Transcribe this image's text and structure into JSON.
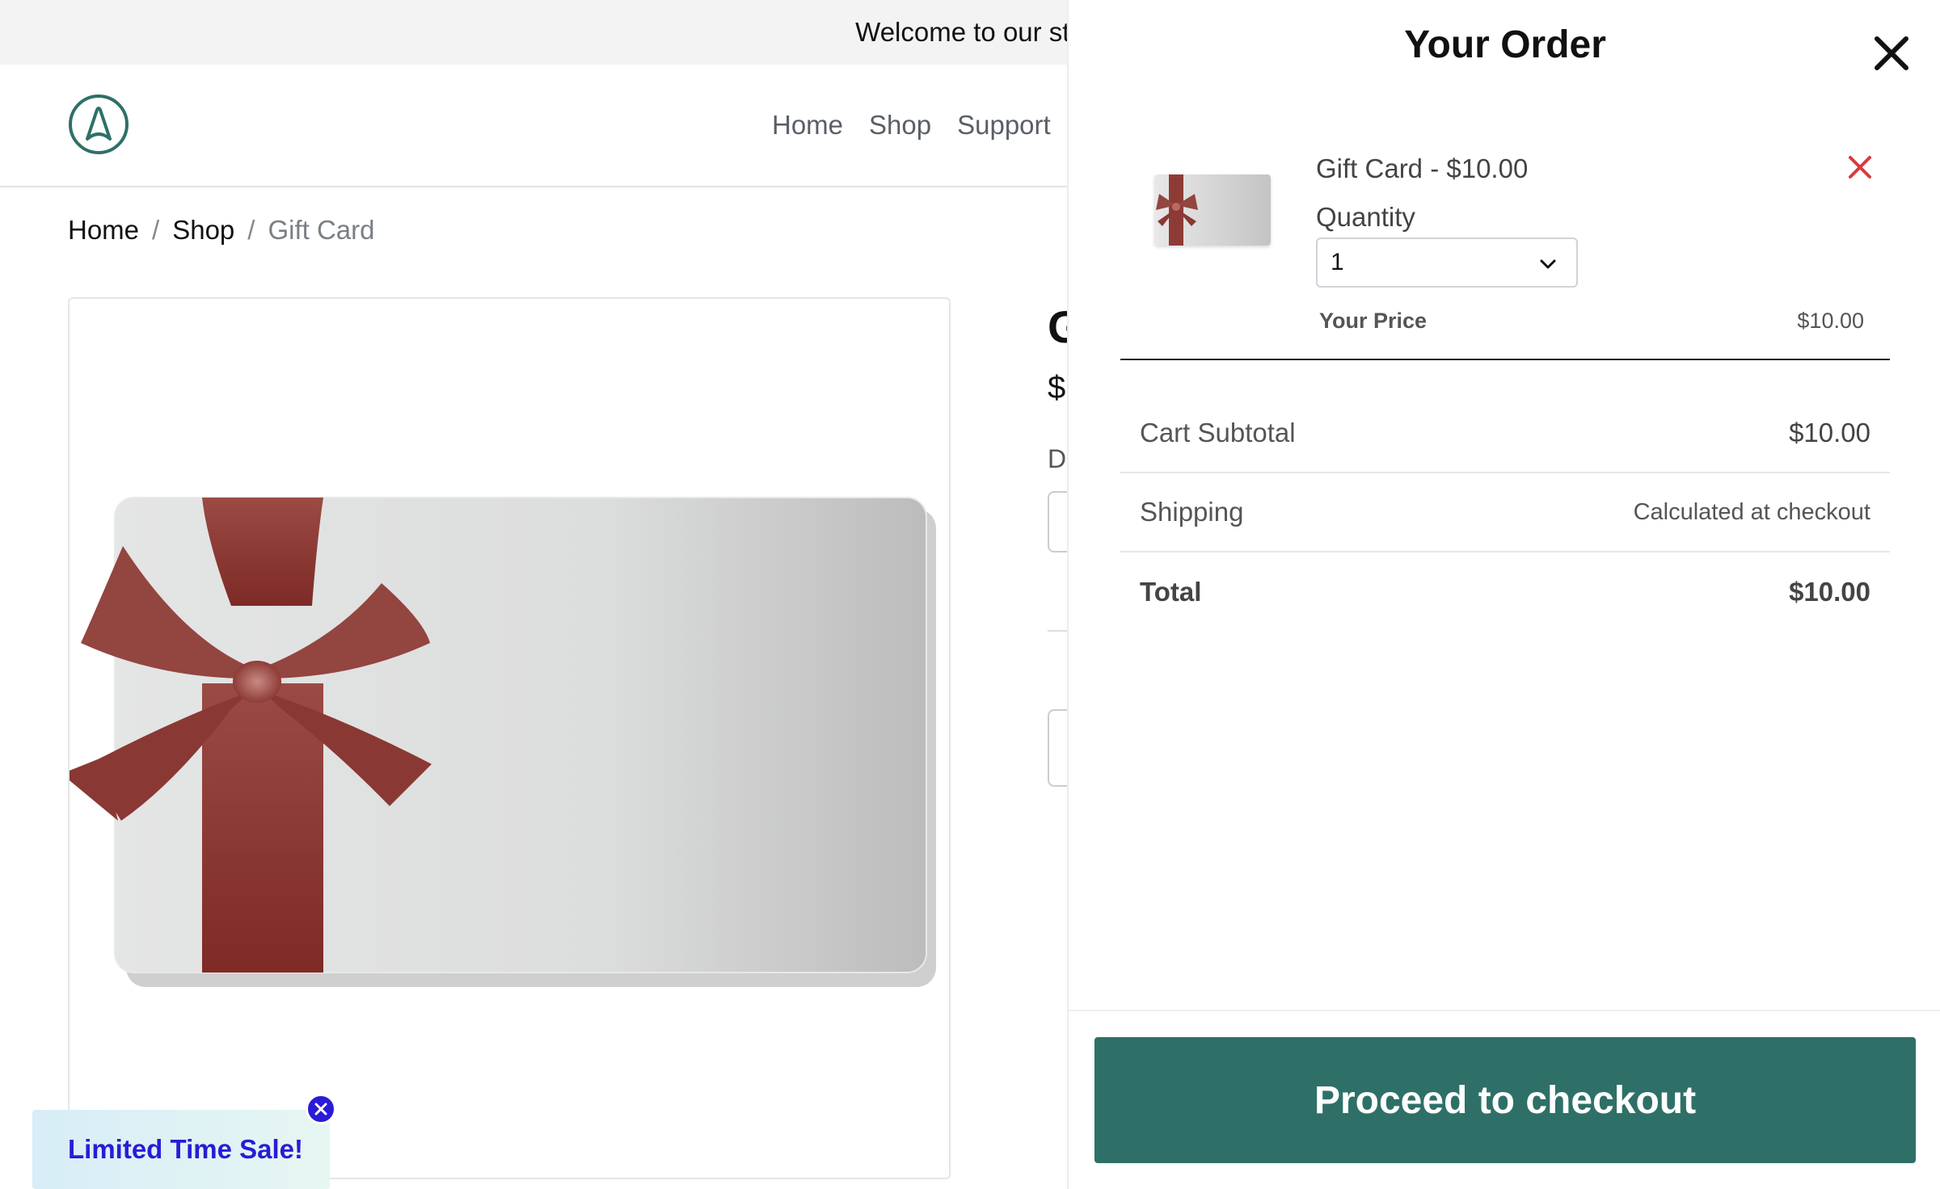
{
  "announcement": {
    "text": "Welcome to our sto"
  },
  "header": {
    "logo_icon": "store-logo-icon",
    "nav": [
      "Home",
      "Shop",
      "Support"
    ]
  },
  "breadcrumb": {
    "items": [
      "Home",
      "Shop"
    ],
    "current": "Gift Card",
    "separator": "/"
  },
  "product": {
    "title_peek": "G",
    "price_peek": "$",
    "label_peek": "D"
  },
  "promo": {
    "label": "Limited Time Sale!",
    "close_icon": "close-circle-icon"
  },
  "cart": {
    "title": "Your Order",
    "close_icon": "close-icon",
    "item": {
      "name": "Gift Card - $10.00",
      "quantity_label": "Quantity",
      "quantity_value": "1",
      "price_label": "Your Price",
      "price_value": "$10.00",
      "remove_icon": "remove-x-icon"
    },
    "summary": {
      "subtotal_label": "Cart Subtotal",
      "subtotal_value": "$10.00",
      "shipping_label": "Shipping",
      "shipping_value": "Calculated at checkout",
      "total_label": "Total",
      "total_value": "$10.00"
    },
    "checkout_label": "Proceed to checkout"
  },
  "colors": {
    "brand": "#2e7067",
    "promo_text": "#2a1bd6",
    "remove_red": "#d9393e",
    "ribbon": "#8e3b36"
  }
}
